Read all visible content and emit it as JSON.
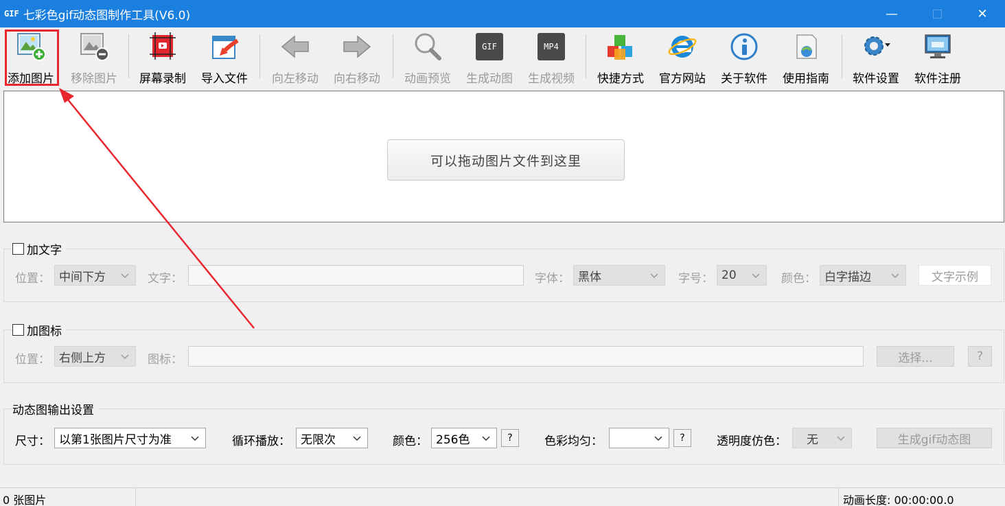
{
  "window": {
    "icon_text": "GIF",
    "title": "七彩色gif动态图制作工具(V6.0)",
    "minimize": "—",
    "close": "✕"
  },
  "toolbar": {
    "add_image": "添加图片",
    "remove_image": "移除图片",
    "screen_record": "屏幕录制",
    "import_file": "导入文件",
    "move_left": "向左移动",
    "move_right": "向右移动",
    "preview": "动画预览",
    "make_gif": "生成动图",
    "make_video": "生成视频",
    "shortcut": "快捷方式",
    "website": "官方网站",
    "about": "关于软件",
    "guide": "使用指南",
    "settings": "软件设置",
    "register": "软件注册",
    "gif_icon_text": "GIF",
    "mp4_icon_text": "MP4"
  },
  "dropzone": {
    "hint": "可以拖动图片文件到这里"
  },
  "text_group": {
    "title": "加文字",
    "position_label": "位置：",
    "position_value": "中间下方",
    "text_label": "文字：",
    "text_value": "",
    "font_label": "字体：",
    "font_value": "黑体",
    "size_label": "字号：",
    "size_value": "20",
    "color_label": "颜色：",
    "color_value": "白字描边",
    "sample_button": "文字示例"
  },
  "icon_group": {
    "title": "加图标",
    "position_label": "位置：",
    "position_value": "右侧上方",
    "icon_label": "图标：",
    "icon_value": "",
    "choose_button": "选择...",
    "help_button": "?"
  },
  "output_group": {
    "title": "动态图输出设置",
    "size_label": "尺寸：",
    "size_value": "以第1张图片尺寸为准",
    "loop_label": "循环播放：",
    "loop_value": "无限次",
    "color_label": "颜色：",
    "color_value": "256色",
    "color_help": "?",
    "balance_label": "色彩均匀：",
    "balance_value": "",
    "balance_help": "?",
    "dither_label": "透明度仿色：",
    "dither_value": "无",
    "generate_button": "生成gif动态图"
  },
  "status": {
    "image_count": "0 张图片",
    "duration": "动画长度: 00:00:00.0"
  },
  "colors": {
    "titlebar": "#1b7fe0",
    "highlight": "#e8262e"
  }
}
